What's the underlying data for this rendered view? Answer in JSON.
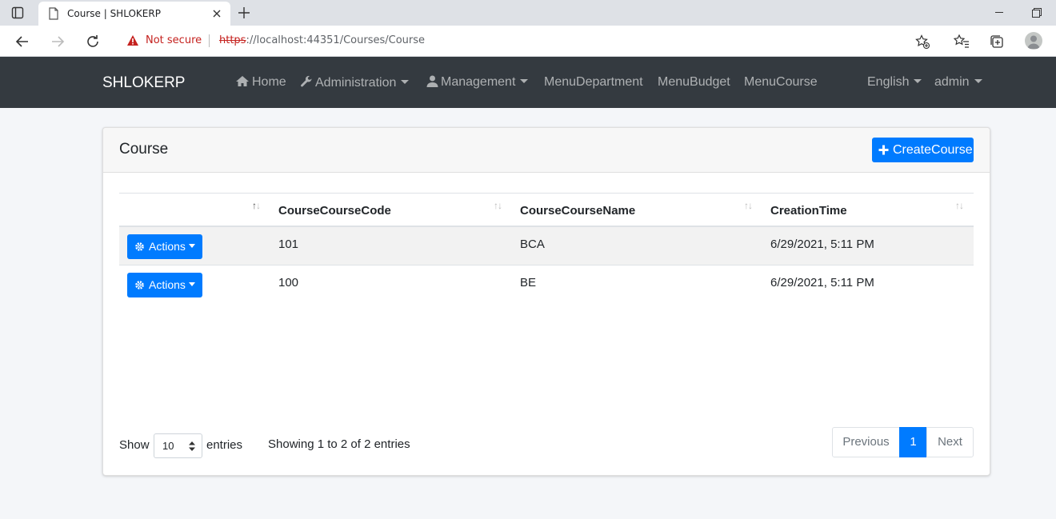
{
  "browser": {
    "tab_title": "Course | SHLOKERP",
    "security_label": "Not secure",
    "url_scheme": "https",
    "url_rest": "://localhost:44351/Courses/Course"
  },
  "navbar": {
    "brand": "SHLOKERP",
    "items": [
      {
        "label": "Home",
        "icon": "home-icon"
      },
      {
        "label": "Administration",
        "icon": "wrench-icon",
        "dropdown": true
      },
      {
        "label": "Management",
        "icon": "user-icon",
        "dropdown": true
      },
      {
        "label": "MenuDepartment"
      },
      {
        "label": "MenuBudget"
      },
      {
        "label": "MenuCourse"
      }
    ],
    "language": "English",
    "user": "admin"
  },
  "card": {
    "title": "Course",
    "create_button": "CreateCourse"
  },
  "table": {
    "columns": [
      "",
      "CourseCourseCode",
      "CourseCourseName",
      "CreationTime"
    ],
    "actions_label": "Actions",
    "rows": [
      {
        "code": "101",
        "name": "BCA",
        "created": "6/29/2021, 5:11 PM"
      },
      {
        "code": "100",
        "name": "BE",
        "created": "6/29/2021, 5:11 PM"
      }
    ]
  },
  "footer": {
    "show": "Show",
    "page_size": "10",
    "entries": "entries",
    "info": "Showing 1 to 2 of 2 entries",
    "pagination": {
      "previous": "Previous",
      "current": "1",
      "next": "Next"
    }
  },
  "colors": {
    "primary": "#007bff",
    "navbar": "#343a40"
  }
}
